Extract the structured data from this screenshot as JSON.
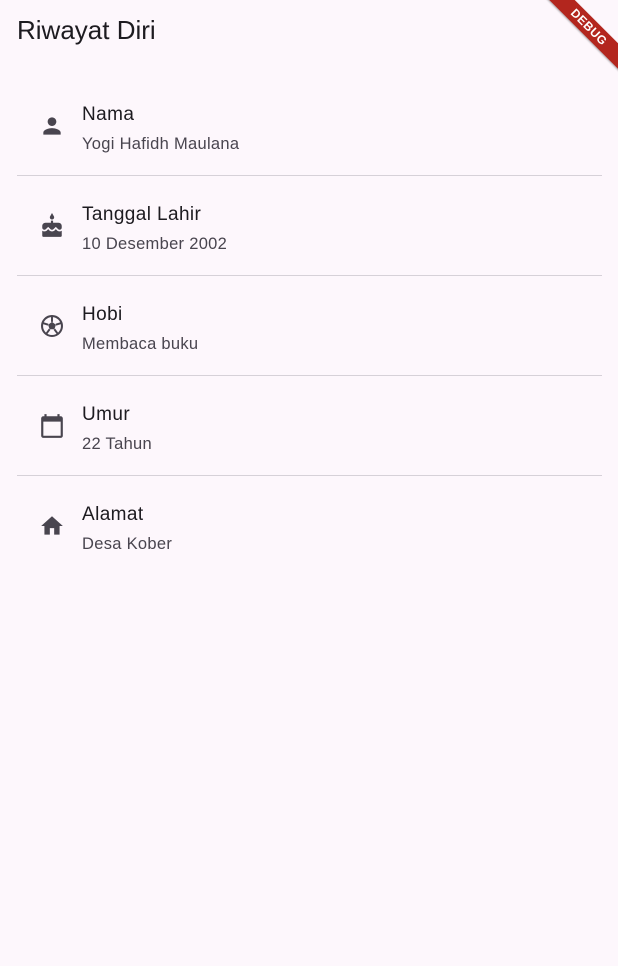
{
  "appbar": {
    "title": "Riwayat Diri"
  },
  "debug_banner": {
    "label": "DEBUG",
    "color": "#b3261e"
  },
  "items": [
    {
      "icon": "person-icon",
      "title": "Nama",
      "subtitle": "Yogi Hafidh Maulana"
    },
    {
      "icon": "cake-icon",
      "title": "Tanggal Lahir",
      "subtitle": "10 Desember 2002"
    },
    {
      "icon": "soccer-ball-icon",
      "title": "Hobi",
      "subtitle": "Membaca buku"
    },
    {
      "icon": "calendar-icon",
      "title": "Umur",
      "subtitle": "22 Tahun"
    },
    {
      "icon": "home-icon",
      "title": "Alamat",
      "subtitle": "Desa Kober"
    }
  ],
  "colors": {
    "background": "#fdf7fc",
    "text_primary": "#1d1b20",
    "text_secondary": "#49454f",
    "divider": "#d6d1d8",
    "icon": "#49454f"
  }
}
